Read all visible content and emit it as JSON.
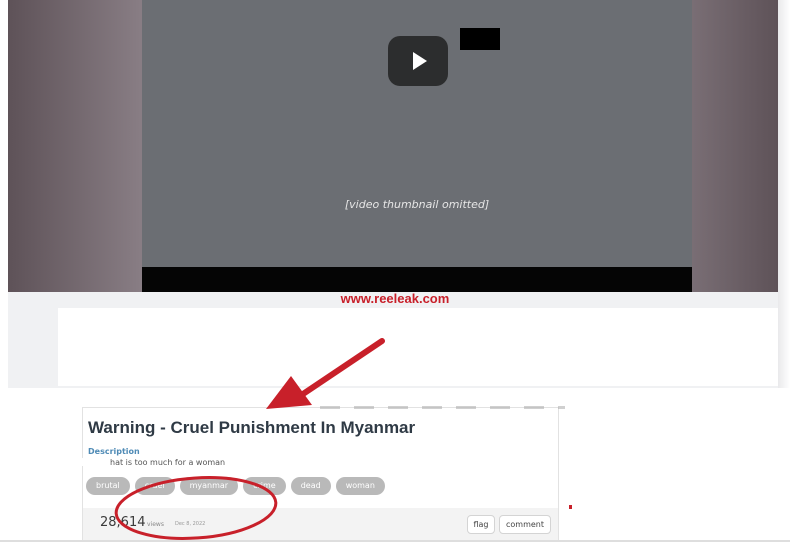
{
  "video": {
    "placeholder": "[video thumbnail omitted]"
  },
  "watermark": "www.reeleak.com",
  "post": {
    "title": "Warning - Cruel Punishment In Myanmar",
    "description_label": "Description",
    "description_text": "hat is too much for a woman",
    "tags": [
      "brutal",
      "cruel",
      "myanmar",
      "crime",
      "dead",
      "woman"
    ],
    "views_count": "28,614",
    "views_label": "views",
    "date": "Dec 8, 2022",
    "flag_label": "flag",
    "comment_label": "comment"
  },
  "annotation": {
    "color": "#c8202a"
  }
}
